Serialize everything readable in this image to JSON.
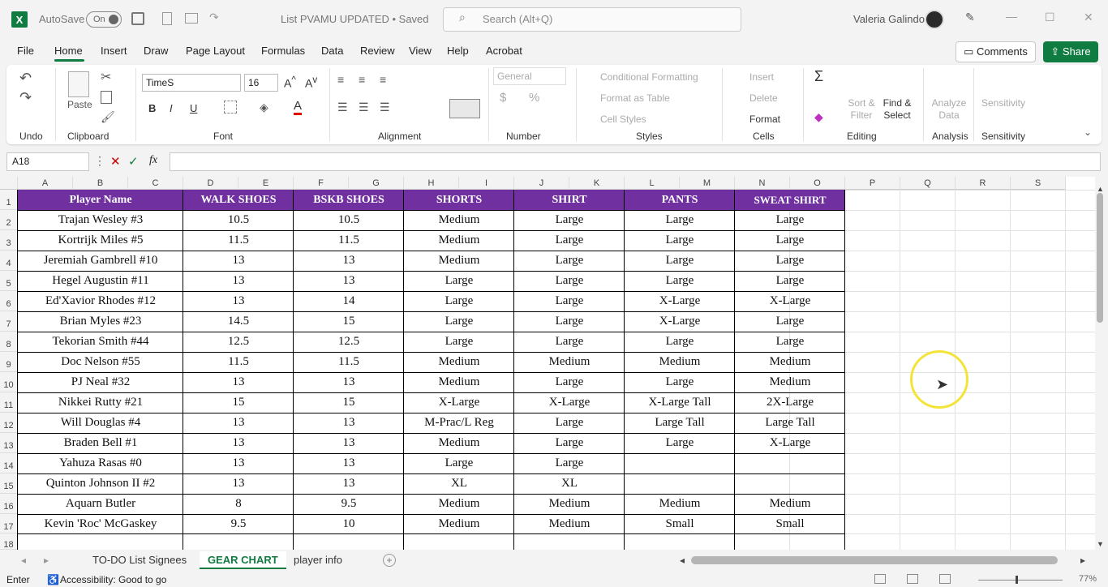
{
  "titlebar": {
    "autosave_label": "AutoSave",
    "autosave_state": "On",
    "doc_title": "List PVAMU UPDATED • Saved",
    "search_placeholder": "Search (Alt+Q)",
    "user_name": "Valeria Galindo"
  },
  "menu": {
    "items": [
      "File",
      "Home",
      "Insert",
      "Draw",
      "Page Layout",
      "Formulas",
      "Data",
      "Review",
      "View",
      "Help",
      "Acrobat"
    ],
    "comments_label": "Comments",
    "share_label": "Share"
  },
  "ribbon": {
    "groups": [
      "Undo",
      "Clipboard",
      "Font",
      "Alignment",
      "Number",
      "Styles",
      "Cells",
      "Editing",
      "Analysis",
      "Sensitivity"
    ],
    "paste_label": "Paste",
    "font_name": "TimeS",
    "font_size": "16",
    "number_format": "General",
    "styles": [
      "Conditional Formatting",
      "Format as Table",
      "Cell Styles"
    ],
    "cells": [
      "Insert",
      "Delete",
      "Format"
    ],
    "sort_filter": "Sort & Filter",
    "find_select": "Find & Select",
    "analyze_data": "Analyze Data",
    "sensitivity": "Sensitivity"
  },
  "formula_bar": {
    "name_box": "A18",
    "fx": "fx",
    "content": ""
  },
  "sheet": {
    "columns": [
      "A",
      "B",
      "C",
      "D",
      "E",
      "F",
      "G",
      "H",
      "I",
      "J",
      "K",
      "L",
      "M",
      "N",
      "O",
      "P",
      "Q",
      "R",
      "S"
    ],
    "rows": [
      "1",
      "2",
      "3",
      "4",
      "5",
      "6",
      "7",
      "8",
      "9",
      "10",
      "11",
      "12",
      "13",
      "14",
      "15",
      "16",
      "17",
      "18"
    ],
    "headers": [
      "Player Name",
      "WALK SHOES",
      "BSKB SHOES",
      "SHORTS",
      "SHIRT",
      "PANTS",
      "SWEAT SHIRT"
    ],
    "data": [
      [
        "Trajan Wesley #3",
        "10.5",
        "10.5",
        "Medium",
        "Large",
        "Large",
        "Large"
      ],
      [
        "Kortrijk Miles #5",
        "11.5",
        "11.5",
        "Medium",
        "Large",
        "Large",
        "Large"
      ],
      [
        "Jeremiah Gambrell #10",
        "13",
        "13",
        "Medium",
        "Large",
        "Large",
        "Large"
      ],
      [
        "Hegel Augustin #11",
        "13",
        "13",
        "Large",
        "Large",
        "Large",
        "Large"
      ],
      [
        "Ed'Xavior Rhodes #12",
        "13",
        "14",
        "Large",
        "Large",
        "X-Large",
        "X-Large"
      ],
      [
        "Brian Myles #23",
        "14.5",
        "15",
        "Large",
        "Large",
        "X-Large",
        "Large"
      ],
      [
        "Tekorian Smith #44",
        "12.5",
        "12.5",
        "Large",
        "Large",
        "Large",
        "Large"
      ],
      [
        "Doc Nelson #55",
        "11.5",
        "11.5",
        "Medium",
        "Medium",
        "Medium",
        "Medium"
      ],
      [
        "PJ Neal #32",
        "13",
        "13",
        "Medium",
        "Large",
        "Large",
        "Medium"
      ],
      [
        "Nikkei Rutty #21",
        "15",
        "15",
        "X-Large",
        "X-Large",
        "X-Large Tall",
        "2X-Large"
      ],
      [
        "Will Douglas #4",
        "13",
        "13",
        "M-Prac/L Reg",
        "Large",
        "Large Tall",
        "Large Tall"
      ],
      [
        "Braden Bell #1",
        "13",
        "13",
        "Medium",
        "Large",
        "Large",
        "X-Large"
      ],
      [
        "Yahuza Rasas #0",
        "13",
        "13",
        "Large",
        "Large",
        "",
        ""
      ],
      [
        "Quinton Johnson II #2",
        "13",
        "13",
        "XL",
        "XL",
        "",
        ""
      ],
      [
        "Aquarn Butler",
        "8",
        "9.5",
        "Medium",
        "Medium",
        "Medium",
        "Medium"
      ],
      [
        "Kevin 'Roc' McGaskey",
        "9.5",
        "10",
        "Medium",
        "Medium",
        "Small",
        "Small"
      ]
    ],
    "header_color": "#7030a0"
  },
  "tabs": {
    "items": [
      "TO-DO List Signees",
      "GEAR CHART",
      "player info"
    ],
    "active": "GEAR CHART"
  },
  "status": {
    "mode": "Enter",
    "accessibility": "Accessibility: Good to go",
    "zoom": "77%"
  }
}
